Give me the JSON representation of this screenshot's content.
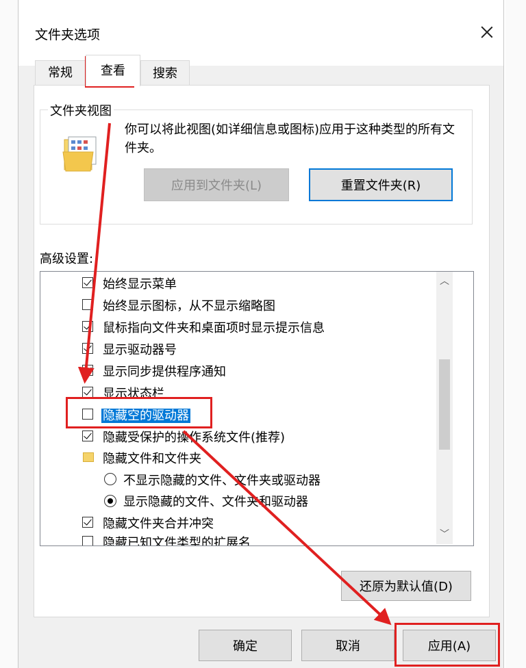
{
  "dialog": {
    "title": "文件夹选项"
  },
  "tabs": [
    {
      "label": "常规",
      "active": false
    },
    {
      "label": "查看",
      "active": true
    },
    {
      "label": "搜索",
      "active": false
    }
  ],
  "folder_views": {
    "group_label": "文件夹视图",
    "description": "你可以将此视图(如详细信息或图标)应用于这种类型的所有文件夹。",
    "apply_button": "应用到文件夹(L)",
    "reset_button": "重置文件夹(R)"
  },
  "advanced": {
    "label": "高级设置:",
    "items": [
      {
        "text": "始终显示菜单",
        "type": "checkbox",
        "checked": true,
        "indent": 0
      },
      {
        "text": "始终显示图标，从不显示缩略图",
        "type": "checkbox",
        "checked": false,
        "indent": 0
      },
      {
        "text": "鼠标指向文件夹和桌面项时显示提示信息",
        "type": "checkbox",
        "checked": true,
        "indent": 0
      },
      {
        "text": "显示驱动器号",
        "type": "checkbox",
        "checked": true,
        "indent": 0
      },
      {
        "text": "显示同步提供程序通知",
        "type": "checkbox",
        "checked": true,
        "indent": 0
      },
      {
        "text": "显示状态栏",
        "type": "checkbox",
        "checked": true,
        "indent": 0
      },
      {
        "text": "隐藏空的驱动器",
        "type": "checkbox",
        "checked": false,
        "indent": 0,
        "selected": true
      },
      {
        "text": "隐藏受保护的操作系统文件(推荐)",
        "type": "checkbox",
        "checked": true,
        "indent": 0
      },
      {
        "text": "隐藏文件和文件夹",
        "type": "folder",
        "indent": 0
      },
      {
        "text": "不显示隐藏的文件、文件夹或驱动器",
        "type": "radio",
        "checked": false,
        "indent": 1
      },
      {
        "text": "显示隐藏的文件、文件夹和驱动器",
        "type": "radio",
        "checked": true,
        "indent": 1
      },
      {
        "text": "隐藏文件夹合并冲突",
        "type": "checkbox",
        "checked": true,
        "indent": 0
      },
      {
        "text": "隐藏已知文件类型的扩展名",
        "type": "checkbox",
        "checked": false,
        "indent": 0
      }
    ],
    "restore_button": "还原为默认值(D)"
  },
  "footer": {
    "ok": "确定",
    "cancel": "取消",
    "apply": "应用(A)"
  },
  "colors": {
    "annotation_red": "#e02020",
    "selection_blue": "#0078d7"
  }
}
